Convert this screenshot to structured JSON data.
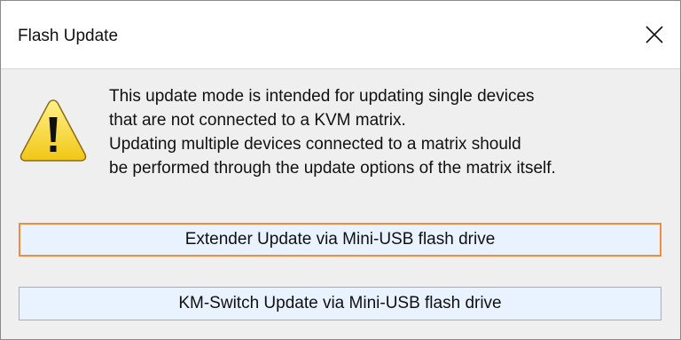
{
  "window": {
    "title": "Flash Update",
    "close_icon": "close-icon"
  },
  "dialog": {
    "icon": "warning-icon",
    "message_lines": [
      "This update mode is intended for updating single devices",
      "that are not connected to a KVM matrix.",
      "Updating multiple devices connected to a matrix should",
      "be performed through the update options of the matrix itself."
    ],
    "buttons": [
      {
        "label": "Extender Update via Mini-USB flash drive",
        "focused": true
      },
      {
        "label": "KM-Switch Update via Mini-USB flash drive",
        "focused": false
      }
    ]
  },
  "colors": {
    "button_background": "#e9f2ff",
    "focus_border": "#f28c3c",
    "warning_fill": "#f8dd3a"
  }
}
